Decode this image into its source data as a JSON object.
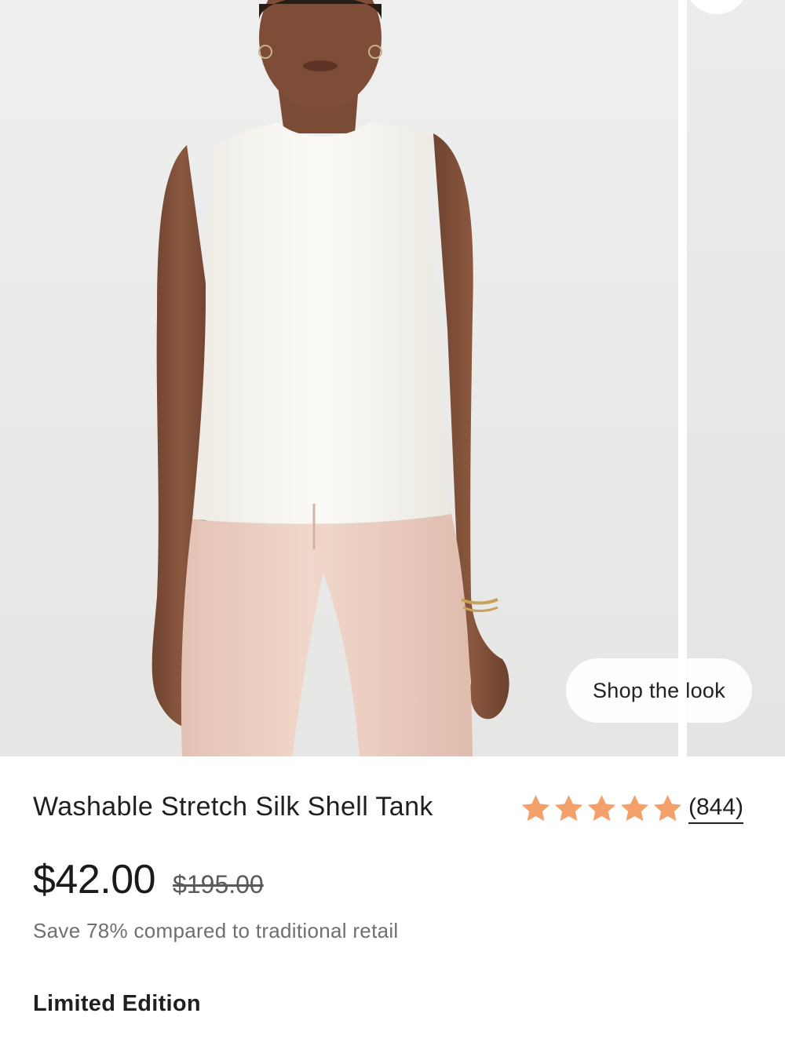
{
  "gallery": {
    "shop_the_look_label": "Shop the look"
  },
  "product": {
    "title": "Washable Stretch Silk Shell Tank",
    "rating": {
      "stars": 5,
      "max_stars": 5,
      "review_count": "(844)",
      "star_color": "#f4a06b"
    },
    "price": "$42.00",
    "compare_price": "$195.00",
    "savings_text": "Save 78% compared to traditional retail",
    "edition_label": "Limited Edition"
  }
}
